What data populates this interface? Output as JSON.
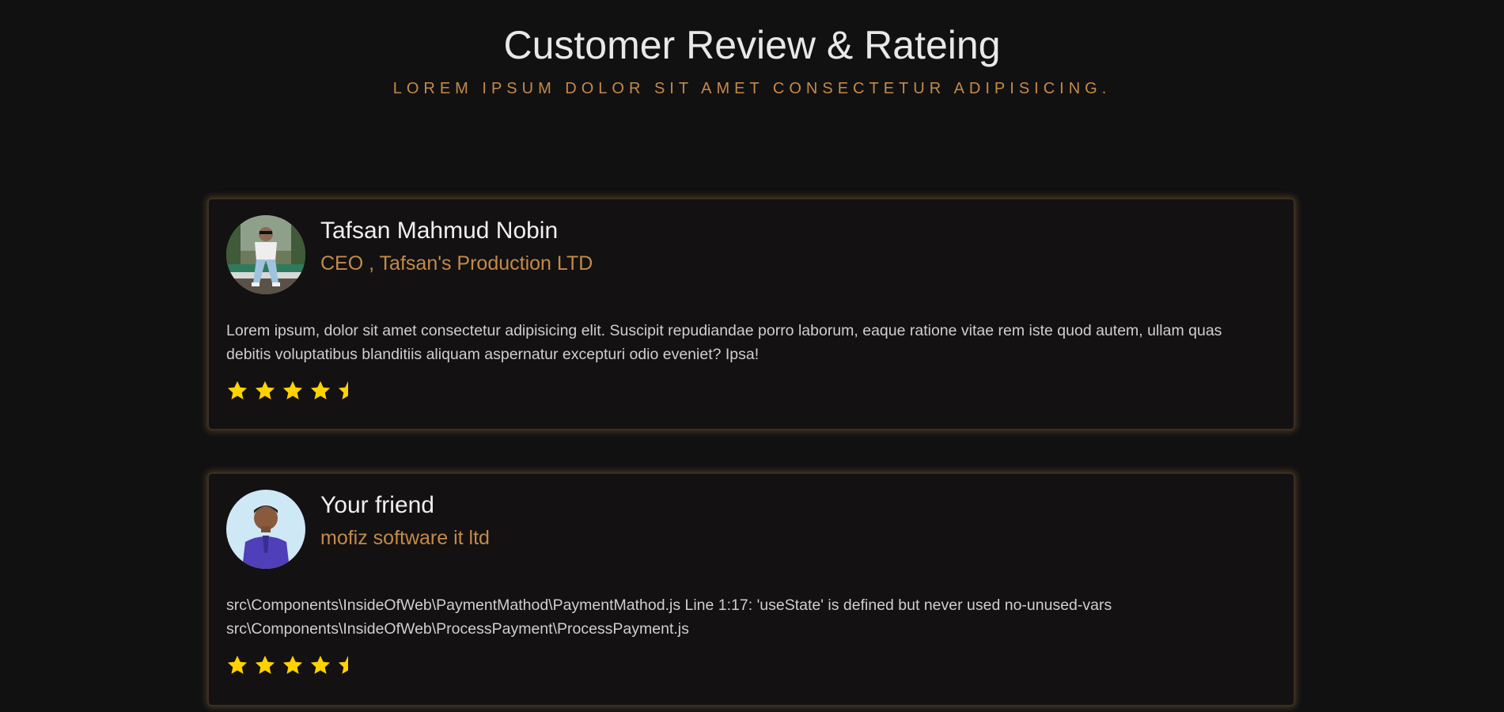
{
  "header": {
    "title": "Customer Review & Rateing",
    "subtitle": "LOREM IPSUM DOLOR SIT AMET CONSECTETUR ADIPISICING."
  },
  "reviews": [
    {
      "name": "Tafsan Mahmud Nobin",
      "role": "CEO , Tafsan's Production LTD",
      "text_lines": [
        "Lorem ipsum, dolor sit amet consectetur adipisicing elit. Suscipit repudiandae porro laborum, eaque ratione vitae rem iste quod autem, ullam quas",
        "debitis voluptatibus blanditiis aliquam aspernatur excepturi odio eveniet? Ipsa!"
      ],
      "rating": 4.5
    },
    {
      "name": "Your friend",
      "role": "mofiz software it ltd",
      "text_lines": [
        "src\\Components\\InsideOfWeb\\PaymentMathod\\PaymentMathod.js Line 1:17: 'useState' is defined but never used no-unused-vars",
        "src\\Components\\InsideOfWeb\\ProcessPayment\\ProcessPayment.js"
      ],
      "rating": 4.5
    }
  ],
  "colors": {
    "accent": "#c48a4a",
    "star": "#ffd200",
    "background": "#121112"
  },
  "icons": {
    "full_star": "star-icon",
    "half_star": "star-half-icon"
  }
}
